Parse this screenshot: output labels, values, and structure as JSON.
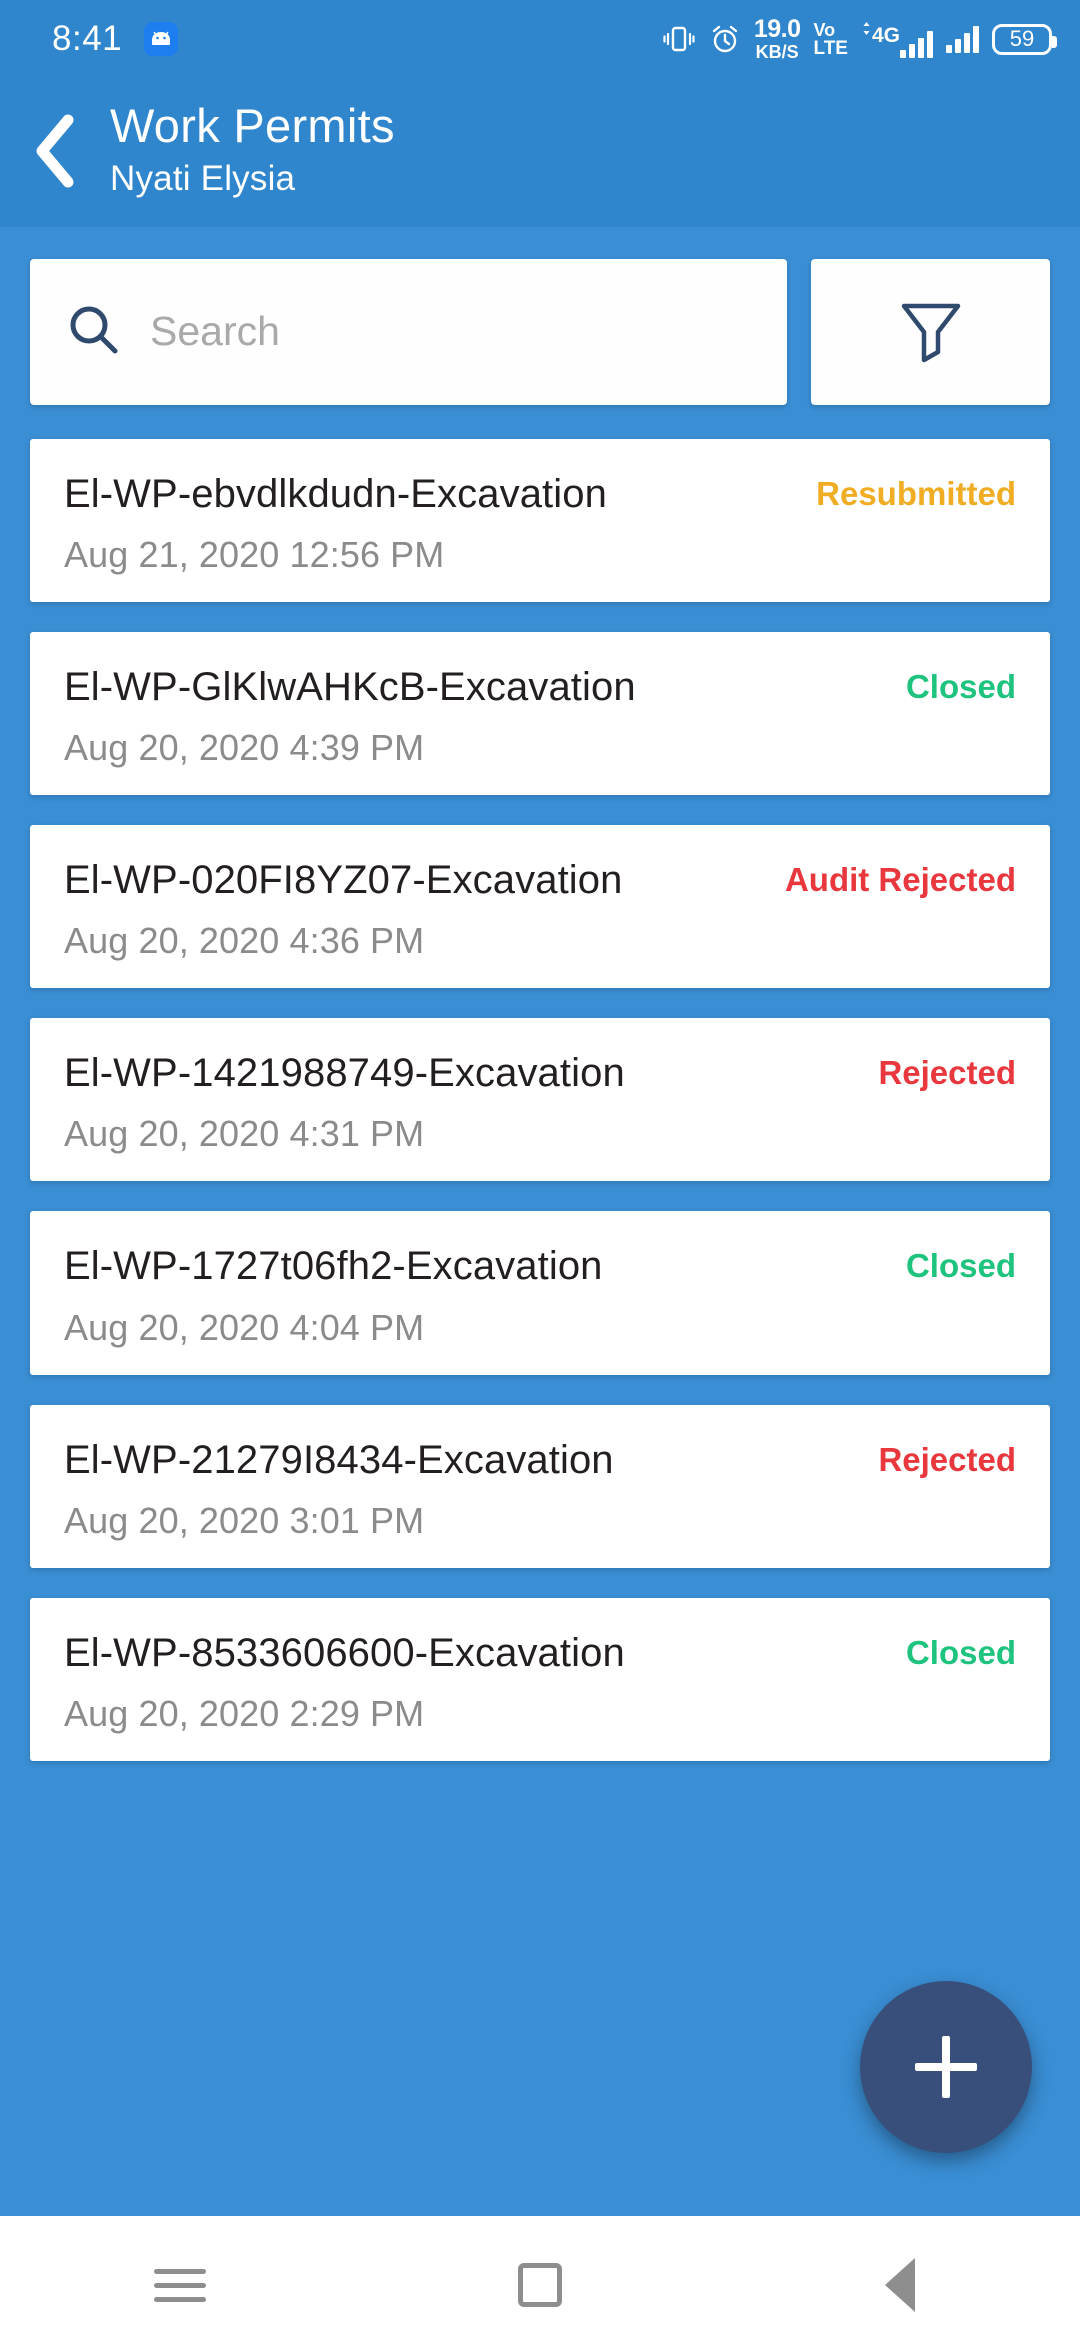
{
  "statusbar": {
    "time": "8:41",
    "app_icon": "android-icon",
    "vibrate_icon": "vibrate-icon",
    "alarm_icon": "alarm-icon",
    "network_speed_value": "19.0",
    "network_speed_unit": "KB/S",
    "volte_line1": "Vo",
    "volte_line2": "LTE",
    "mobile_data_label": "4G",
    "signal_icon_1": "signal-bars-icon",
    "signal_icon_2": "signal-bars-icon",
    "battery_level": "59"
  },
  "appbar": {
    "back_icon": "back-chevron-icon",
    "title": "Work Permits",
    "subtitle": "Nyati Elysia"
  },
  "search": {
    "icon": "search-icon",
    "placeholder": "Search",
    "value": ""
  },
  "filter": {
    "icon": "filter-funnel-icon",
    "label": "Filter"
  },
  "colors": {
    "header_blue": "#2f86cd",
    "body_blue": "#3a8ed4",
    "status_resubmitted": "#f0ad24",
    "status_closed": "#1ec37e",
    "status_rejected": "#e8383d",
    "fab_navy": "#374f7a",
    "title_text": "#231f20",
    "date_text": "#8b8b8b"
  },
  "permits": [
    {
      "title": "El-WP-ebvdlkdudn-Excavation",
      "date": "Aug 21, 2020 12:56 PM",
      "status": "Resubmitted",
      "status_color": "#f0ad24"
    },
    {
      "title": "El-WP-GlKlwAHKcB-Excavation",
      "date": "Aug 20, 2020 4:39 PM",
      "status": "Closed",
      "status_color": "#1ec37e"
    },
    {
      "title": "El-WP-020FI8YZ07-Excavation",
      "date": "Aug 20, 2020 4:36 PM",
      "status": "Audit Rejected",
      "status_color": "#e8383d"
    },
    {
      "title": "El-WP-1421988749-Excavation",
      "date": "Aug 20, 2020 4:31 PM",
      "status": "Rejected",
      "status_color": "#e8383d"
    },
    {
      "title": "El-WP-1727t06fh2-Excavation",
      "date": "Aug 20, 2020 4:04 PM",
      "status": "Closed",
      "status_color": "#1ec37e"
    },
    {
      "title": "El-WP-21279I8434-Excavation",
      "date": "Aug 20, 2020 3:01 PM",
      "status": "Rejected",
      "status_color": "#e8383d"
    },
    {
      "title": "El-WP-8533606600-Excavation",
      "date": "Aug 20, 2020 2:29 PM",
      "status": "Closed",
      "status_color": "#1ec37e"
    }
  ],
  "fab": {
    "icon": "plus-icon",
    "label": "Add work permit"
  },
  "navbar": {
    "recents_icon": "menu-recents-icon",
    "home_icon": "home-square-icon",
    "back_icon": "back-triangle-icon"
  }
}
